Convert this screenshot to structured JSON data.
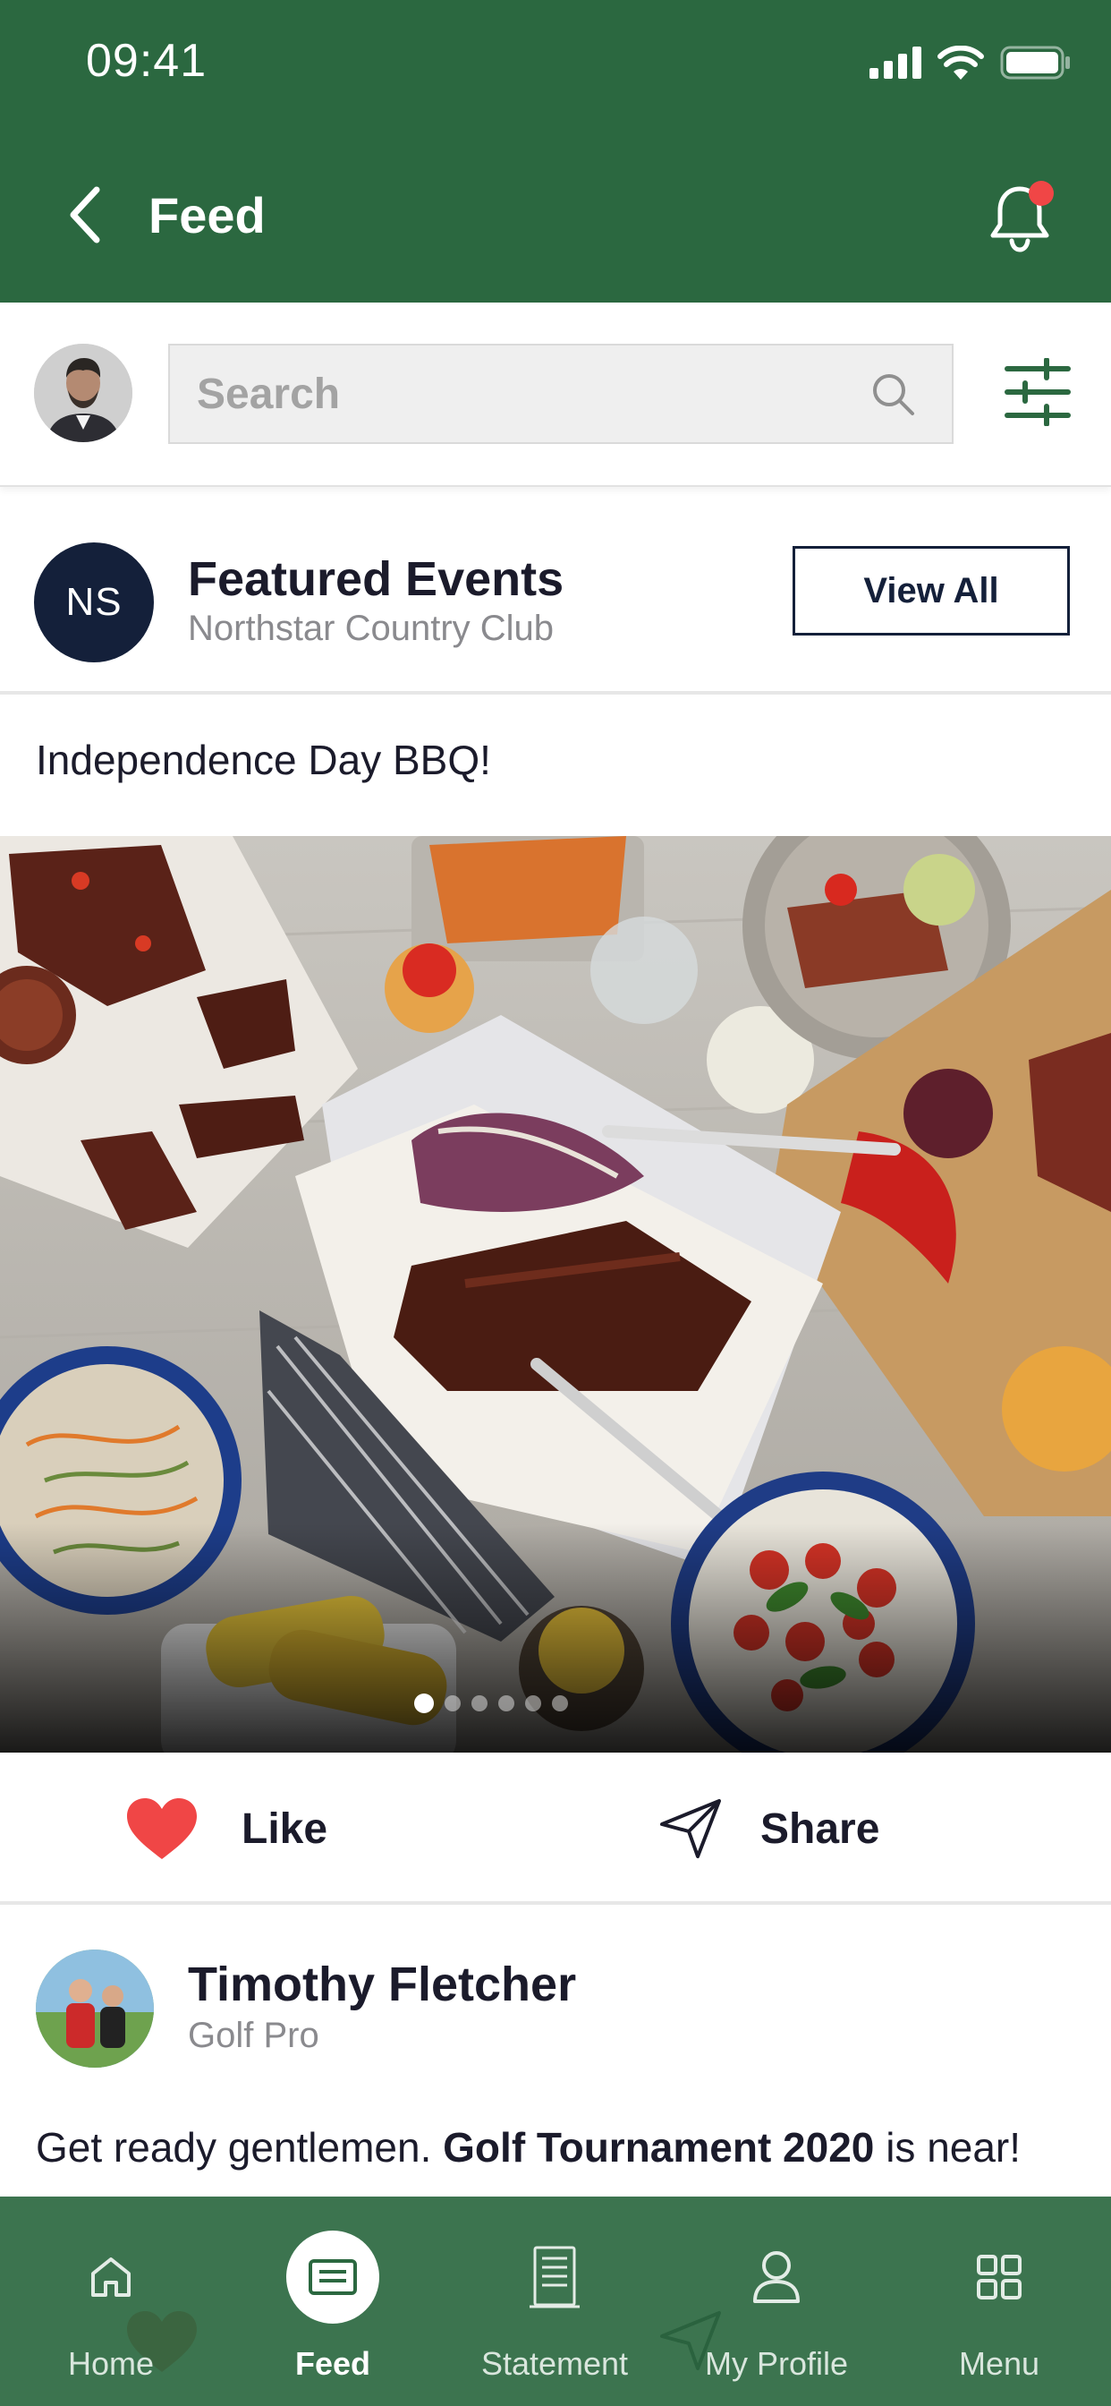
{
  "status_bar": {
    "time": "09:41"
  },
  "nav": {
    "title": "Feed",
    "has_notification": true
  },
  "search": {
    "placeholder": "Search",
    "value": ""
  },
  "featured": {
    "avatar_initials": "NS",
    "title": "Featured Events",
    "subtitle": "Northstar Country Club",
    "view_all_label": "View All"
  },
  "event": {
    "title": "Independence Day BBQ!",
    "carousel": {
      "total": 6,
      "active_index": 0
    }
  },
  "actions": {
    "like_label": "Like",
    "share_label": "Share"
  },
  "post": {
    "author": "Timothy Fletcher",
    "role": "Golf Pro",
    "text_plain": "Get ready gentlemen.",
    "text_bold": "Golf Tournament 2020",
    "text_end": "is near!"
  },
  "tabs": [
    {
      "label": "Home",
      "icon": "home-icon",
      "active": false
    },
    {
      "label": "Feed",
      "icon": "feed-icon",
      "active": true
    },
    {
      "label": "Statement",
      "icon": "statement-icon",
      "active": false
    },
    {
      "label": "My Profile",
      "icon": "profile-icon",
      "active": false
    },
    {
      "label": "Menu",
      "icon": "grid-icon",
      "active": false
    }
  ],
  "colors": {
    "brand_green": "#2b6840",
    "navy": "#14203a",
    "like_red": "#f04646",
    "muted_text": "#8a8a8e"
  }
}
